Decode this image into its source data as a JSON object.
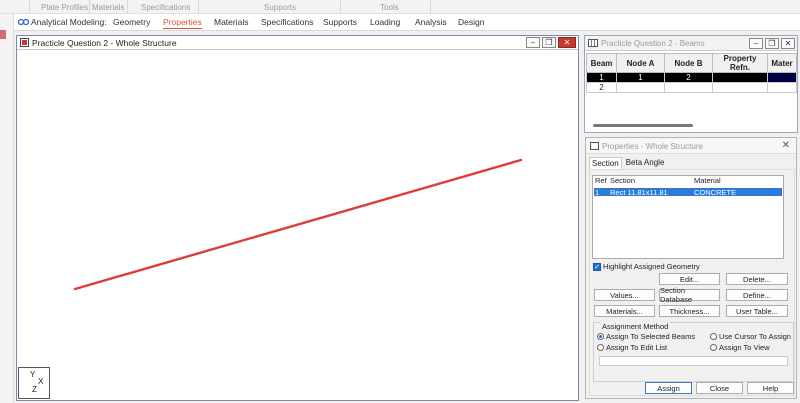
{
  "ribbon_groups": [
    "Plate Profiles",
    "Materials",
    "Specifications",
    "Supports",
    "Tools"
  ],
  "workflow": {
    "label": "Analytical Modeling:",
    "tabs": [
      {
        "label": "Geometry",
        "active": false
      },
      {
        "label": "Properties",
        "active": true
      },
      {
        "label": "Materials",
        "active": false
      },
      {
        "label": "Specifications",
        "active": false
      },
      {
        "label": "Supports",
        "active": false
      },
      {
        "label": "Loading",
        "active": false
      },
      {
        "label": "Analysis",
        "active": false
      },
      {
        "label": "Design",
        "active": false
      }
    ]
  },
  "main_window": {
    "title": "Practicle Question 2 - Whole Structure",
    "axis_labels": {
      "y": "Y",
      "x": "X",
      "z": "Z"
    }
  },
  "beams_window": {
    "title": "Practicle Question 2 - Beams",
    "columns": [
      "Beam",
      "Node A",
      "Node B",
      "Property Refn.",
      "Mater"
    ],
    "rows": [
      {
        "beam": "1",
        "node_a": "1",
        "node_b": "2",
        "property": "",
        "material": "",
        "selected": true
      },
      {
        "beam": "2",
        "node_a": "",
        "node_b": "",
        "property": "",
        "material": "",
        "selected": false
      }
    ]
  },
  "properties_panel": {
    "title": "Properties - Whole Structure",
    "tabs": [
      "Section",
      "Beta Angle"
    ],
    "list_headers": {
      "ref": "Ref",
      "section": "Section",
      "material": "Material"
    },
    "list_row": {
      "ref": "1",
      "section": "Rect 11.81x11.81",
      "material": "CONCRETE"
    },
    "highlight_label": "Highlight Assigned Geometry",
    "buttons": {
      "edit": "Edit...",
      "delete": "Delete...",
      "values": "Values...",
      "section_database": "Section Database",
      "define": "Define...",
      "materials": "Materials...",
      "thickness": "Thickness...",
      "user_table": "User Table..."
    },
    "assignment": {
      "legend": "Assignment Method",
      "selected_beams": "Assign To Selected Beams",
      "cursor": "Use Cursor To Assign",
      "edit_list": "Assign To Edit List",
      "view": "Assign To View"
    },
    "footer": {
      "assign": "Assign",
      "close": "Close",
      "help": "Help"
    }
  },
  "colors": {
    "beam_line": "#e03a3a",
    "active_tab": "#d35a3a",
    "selection": "#2d7bd8"
  }
}
